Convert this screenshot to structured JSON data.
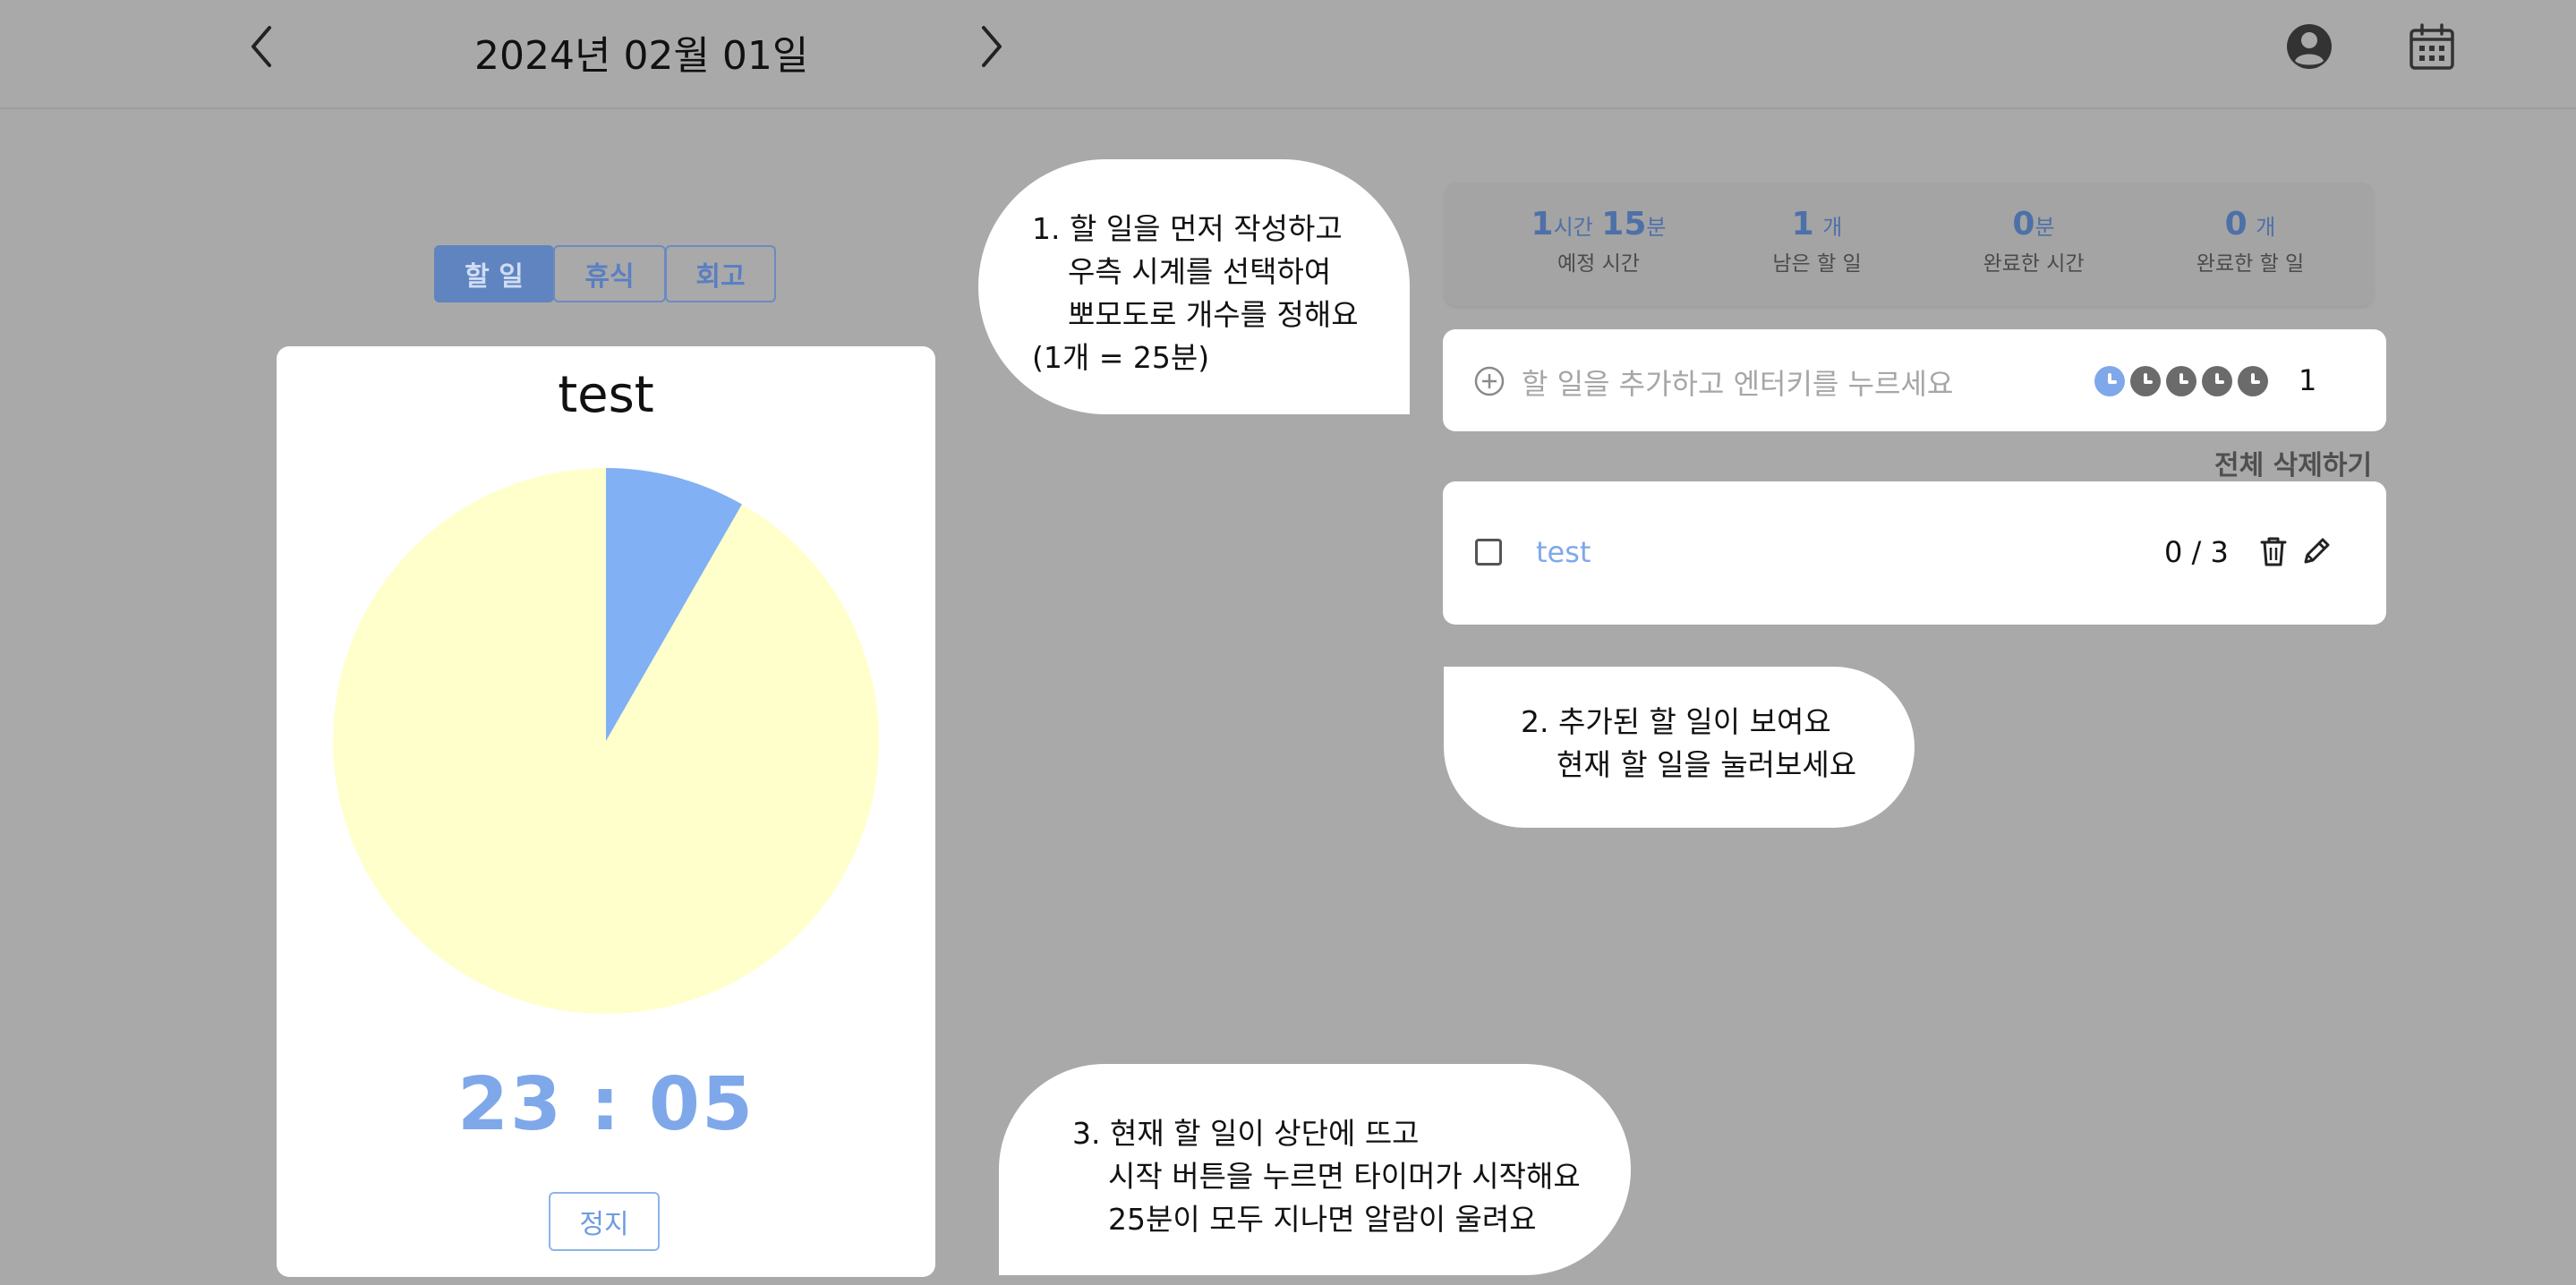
{
  "header": {
    "date": "2024년 02월 01일"
  },
  "tabs": [
    {
      "label": "할 일",
      "active": true
    },
    {
      "label": "휴식",
      "active": false
    },
    {
      "label": "회고",
      "active": false
    }
  ],
  "timer": {
    "title": "test",
    "time": "23 : 05",
    "stop_label": "정지",
    "elapsed_fraction": 0.083,
    "colors": {
      "elapsed": "#82b0f4",
      "remaining": "#ffffcc"
    }
  },
  "guides": {
    "g1": [
      "1. 할 일을 먼저 작성하고",
      "우측 시계를 선택하여",
      "뽀모도로 개수를 정해요",
      "(1개 = 25분)"
    ],
    "g2": [
      "2. 추가된 할 일이 보여요",
      "현재 할 일을 눌러보세요"
    ],
    "g3": [
      "3. 현재 할 일이 상단에 뜨고",
      "시작 버튼을 누르면 타이머가 시작해요",
      "25분이 모두 지나면 알람이 울려요"
    ]
  },
  "stats": {
    "planned": {
      "hours": "1",
      "hours_unit": "시간",
      "minutes": "15",
      "minutes_unit": "분",
      "label": "예정 시간"
    },
    "remaining": {
      "value": "1",
      "unit": "개",
      "label": "남은 할 일"
    },
    "completed_time": {
      "value": "0",
      "unit": "분",
      "label": "완료한 시간"
    },
    "completed_tasks": {
      "value": "0",
      "unit": "개",
      "label": "완료한 할 일"
    }
  },
  "add_task": {
    "placeholder": "할 일을 추가하고 엔터키를 누르세요",
    "pomodoro_selected": 1,
    "pomodoro_total": 5,
    "count": "1"
  },
  "delete_all_label": "전체 삭제하기",
  "todos": [
    {
      "text": "test",
      "progress": "0 / 3",
      "done": false
    }
  ],
  "colors": {
    "accent": "#7fa8ea",
    "background": "#a9a9a9"
  }
}
